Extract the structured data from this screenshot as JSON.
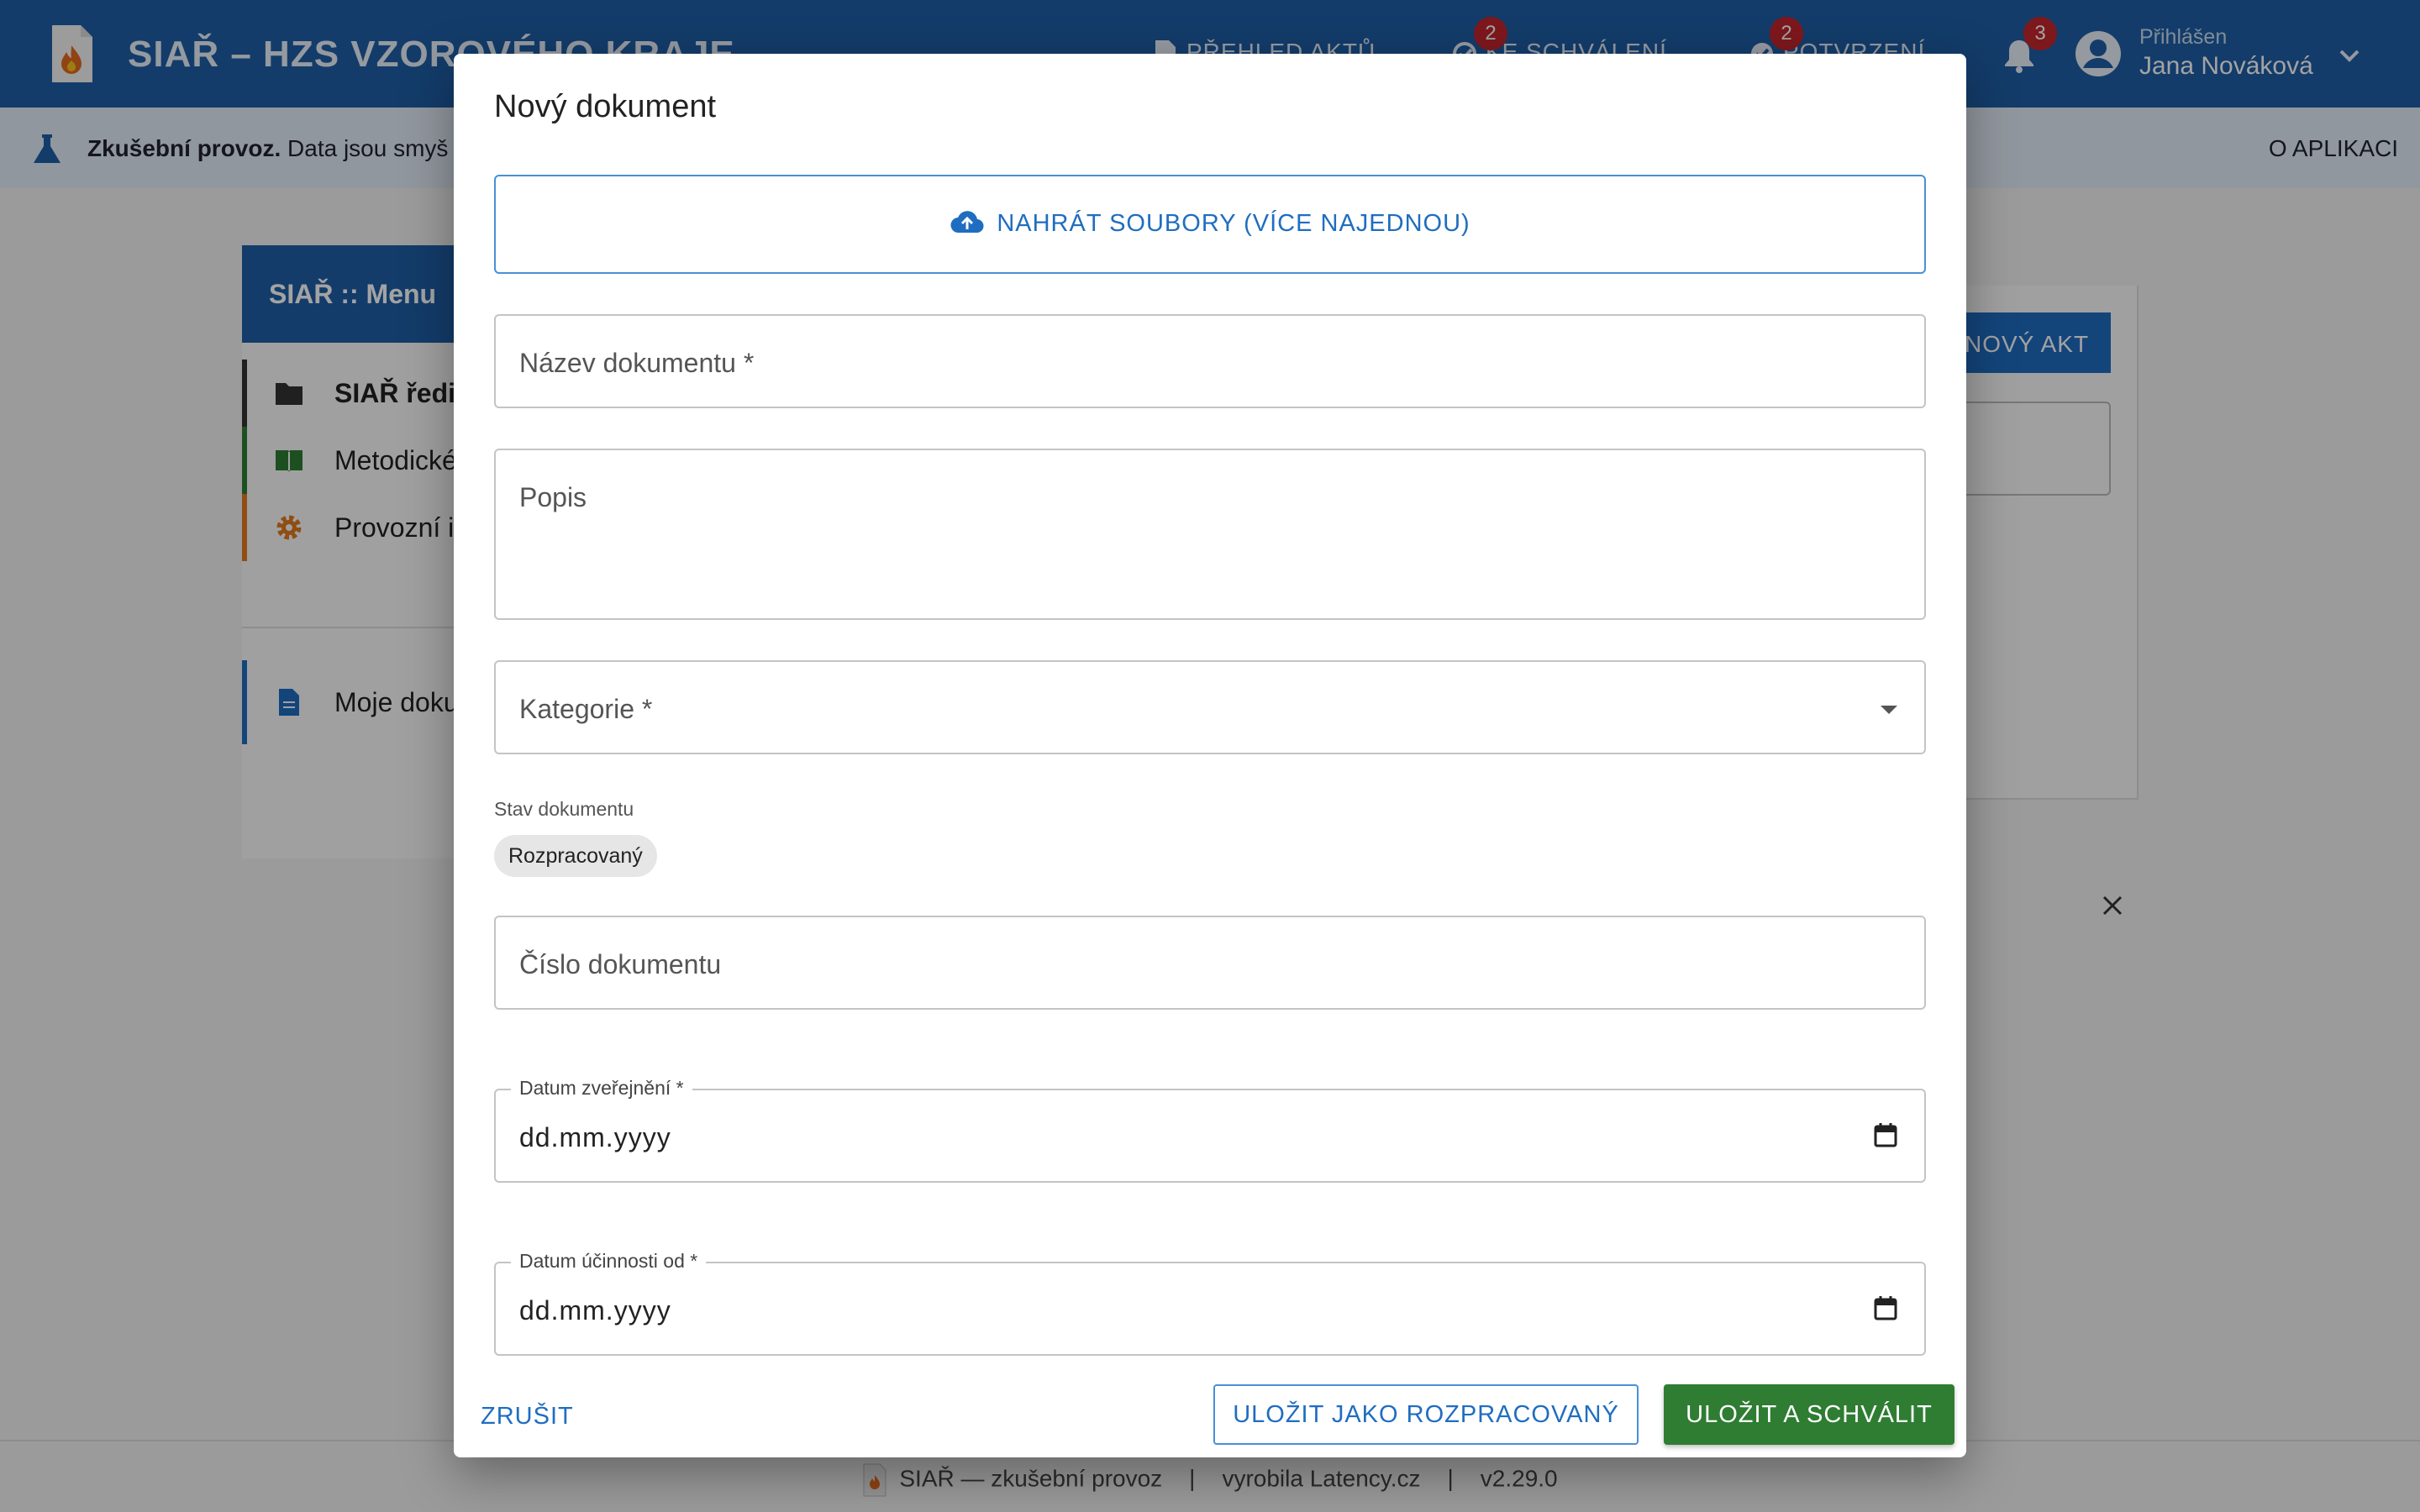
{
  "header": {
    "app_title": "SIAŘ – HZS VZOROVÉHO KRAJE",
    "nav": [
      {
        "label": "PŘEHLED AKTŮ"
      },
      {
        "label": "KE SCHVÁLENÍ",
        "badge": "2"
      },
      {
        "label": "POTVRZENÍ",
        "badge": "2"
      }
    ],
    "notifications_badge": "3",
    "user_status": "Přihlášen",
    "user_name": "Jana Nováková"
  },
  "infobar": {
    "bold": "Zkušební provoz.",
    "text": " Data jsou smyš",
    "about": "O APLIKACI"
  },
  "menu": {
    "title": "SIAŘ :: Menu",
    "items": [
      {
        "label": "SIAŘ ředi",
        "color": "#333333"
      },
      {
        "label": "Metodické",
        "color": "#2e7d32"
      },
      {
        "label": "Provozní i",
        "color": "#e07a1f"
      }
    ],
    "my_docs": "Moje doku"
  },
  "background": {
    "new_act_button": "NOVÝ AKT"
  },
  "modal": {
    "title": "Nový dokument",
    "upload_label": "NAHRÁT SOUBORY (VÍCE NAJEDNOU)",
    "name_placeholder": "Název dokumentu *",
    "description_placeholder": "Popis",
    "category_placeholder": "Kategorie *",
    "status_label": "Stav dokumentu",
    "status_value": "Rozpracovaný",
    "number_placeholder": "Číslo dokumentu",
    "published_date_label": "Datum zveřejnění *",
    "published_date_value": "dd.mm.yyyy",
    "effective_date_label": "Datum účinnosti od *",
    "effective_date_value": "dd.mm.yyyy",
    "cancel_label": "ZRUŠIT",
    "save_draft_label": "ULOŽIT JAKO ROZPRACOVANÝ",
    "save_approve_label": "ULOŽIT A SCHVÁLIT"
  },
  "footer": {
    "name": "SIAŘ — zkušební provoz",
    "made_by": "vyrobila Latency.cz",
    "version": "v2.29.0"
  },
  "colors": {
    "primary": "#1f5fa6",
    "accent_blue": "#1f6dc0",
    "approve_green": "#2e7d32",
    "badge_red": "#c4262e"
  }
}
